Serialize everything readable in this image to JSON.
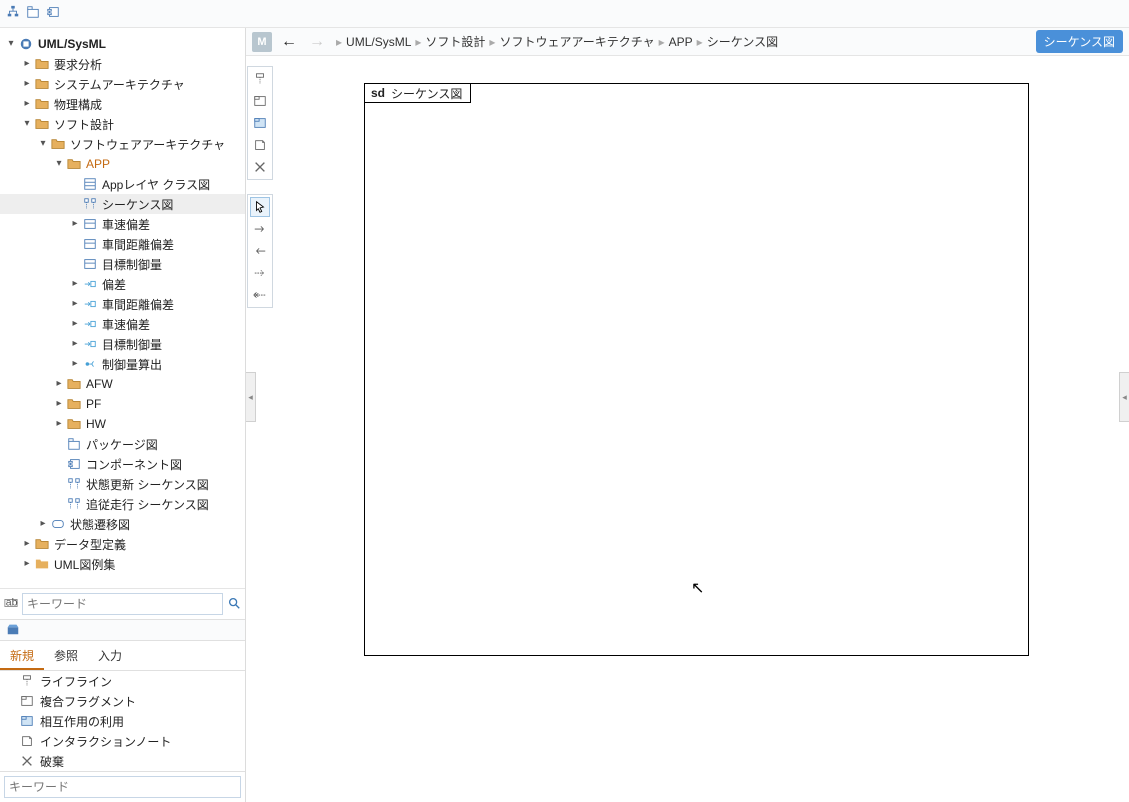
{
  "top_toolbar": {
    "icons": [
      "hierarchy",
      "copy-struct",
      "refresh-struct"
    ]
  },
  "tree": {
    "root": {
      "label": "UML/SysML",
      "expanded": true
    },
    "level1": [
      {
        "label": "要求分析",
        "icon": "folder",
        "expanded": false
      },
      {
        "label": "システムアーキテクチャ",
        "icon": "folder",
        "expanded": false
      },
      {
        "label": "物理構成",
        "icon": "folder",
        "expanded": false
      },
      {
        "label": "ソフト設計",
        "icon": "folder",
        "expanded": true,
        "children": [
          {
            "label": "ソフトウェアアーキテクチャ",
            "icon": "folder",
            "expanded": true,
            "children": [
              {
                "label": "APP",
                "icon": "folder",
                "expanded": true,
                "highlight": true,
                "children": [
                  {
                    "label": "Appレイヤ クラス図",
                    "icon": "class-diagram"
                  },
                  {
                    "label": "シーケンス図",
                    "icon": "seq-diagram",
                    "selected": true
                  },
                  {
                    "label": "車速偏差",
                    "icon": "block",
                    "expandable": true
                  },
                  {
                    "label": "車間距離偏差",
                    "icon": "block",
                    "expandable": false
                  },
                  {
                    "label": "目標制御量",
                    "icon": "block",
                    "expandable": false
                  },
                  {
                    "label": "偏差",
                    "icon": "port",
                    "expandable": true
                  },
                  {
                    "label": "車間距離偏差",
                    "icon": "port",
                    "expandable": true
                  },
                  {
                    "label": "車速偏差",
                    "icon": "port",
                    "expandable": true
                  },
                  {
                    "label": "目標制御量",
                    "icon": "port",
                    "expandable": true
                  },
                  {
                    "label": "制御量算出",
                    "icon": "op",
                    "expandable": true
                  }
                ]
              },
              {
                "label": "AFW",
                "icon": "folder",
                "expandable": true
              },
              {
                "label": "PF",
                "icon": "folder",
                "expandable": true
              },
              {
                "label": "HW",
                "icon": "folder",
                "expandable": true
              },
              {
                "label": "パッケージ図",
                "icon": "pkg-diagram"
              },
              {
                "label": "コンポーネント図",
                "icon": "comp-diagram"
              },
              {
                "label": "状態更新 シーケンス図",
                "icon": "seq-diagram"
              },
              {
                "label": "追従走行 シーケンス図",
                "icon": "seq-diagram"
              }
            ]
          },
          {
            "label": "状態遷移図",
            "icon": "state-diagram",
            "expandable": true
          }
        ]
      },
      {
        "label": "データ型定義",
        "icon": "folder",
        "expanded": false
      },
      {
        "label": "UML図例集",
        "icon": "folder-plain",
        "expanded": false
      }
    ]
  },
  "search": {
    "placeholder": "キーワード"
  },
  "palette": {
    "tabs": [
      "新規",
      "参照",
      "入力"
    ],
    "active_tab": 0,
    "items": [
      {
        "label": "ライフライン",
        "icon": "lifeline"
      },
      {
        "label": "複合フラグメント",
        "icon": "fragment"
      },
      {
        "label": "相互作用の利用",
        "icon": "interaction-use"
      },
      {
        "label": "インタラクションノート",
        "icon": "note"
      },
      {
        "label": "破棄",
        "icon": "destroy"
      }
    ],
    "keyword_placeholder": "キーワード"
  },
  "header": {
    "badge": "M",
    "breadcrumb": [
      "UML/SysML",
      "ソフト設計",
      "ソフトウェアアーキテクチャ",
      "APP",
      "シーケンス図"
    ],
    "type_badge": "シーケンス図"
  },
  "tool_palette_1": [
    "lifeline",
    "fragment",
    "interaction-use",
    "note",
    "destroy"
  ],
  "tool_palette_2": [
    "pointer",
    "arrow-right",
    "arrow-left",
    "dash-right",
    "dash-left-x"
  ],
  "diagram": {
    "sd_prefix": "sd",
    "sd_title": "シーケンス図"
  }
}
